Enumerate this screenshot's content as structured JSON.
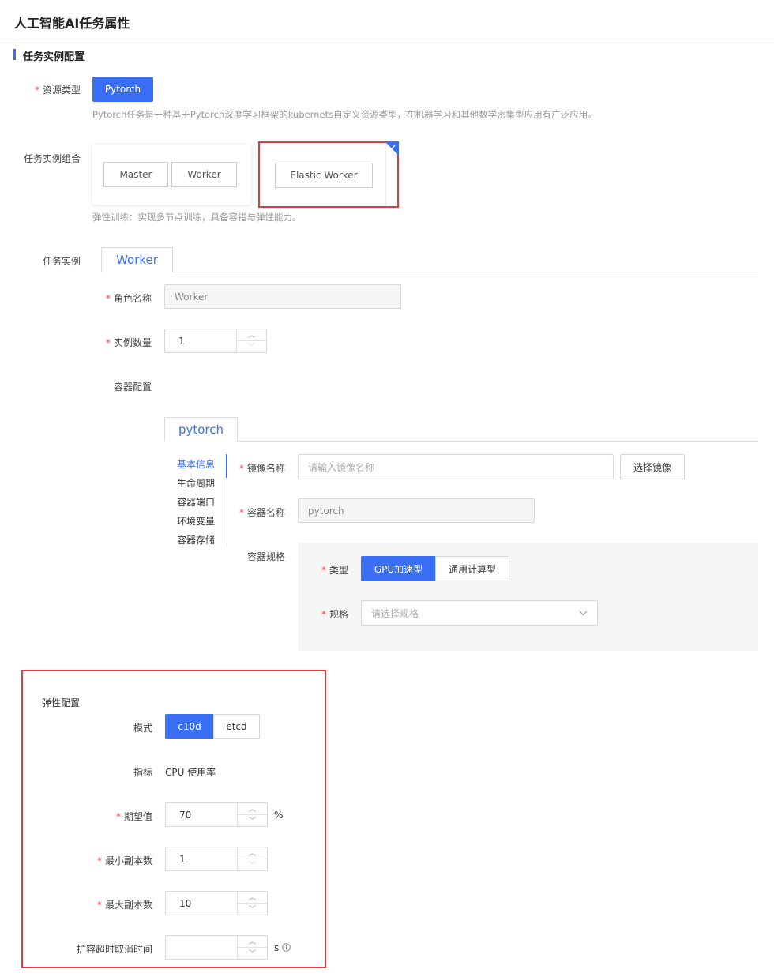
{
  "page_title": "人工智能AI任务属性",
  "section_title": "任务实例配置",
  "resource_type": {
    "label": "资源类型",
    "button": "Pytorch",
    "hint": "Pytorch任务是一种基于Pytorch深度学习框架的kubernets自定义资源类型，在机器学习和其他数学密集型应用有广泛应用。"
  },
  "instance_combo": {
    "label": "任务实例组合",
    "options": [
      {
        "buttons": [
          "Master",
          "Worker"
        ],
        "selected": false
      },
      {
        "buttons": [
          "Elastic Worker"
        ],
        "selected": true
      }
    ],
    "hint": "弹性训练：实现多节点训练，具备容错与弹性能力。"
  },
  "task_instance": {
    "label": "任务实例",
    "tab": "Worker",
    "role_name_label": "角色名称",
    "role_name_value": "Worker",
    "instance_count_label": "实例数量",
    "instance_count_value": "1",
    "container_config_label": "容器配置"
  },
  "container": {
    "tab": "pytorch",
    "menu": [
      "基本信息",
      "生命周期",
      "容器端口",
      "环境变量",
      "容器存储"
    ],
    "active_menu": "基本信息",
    "image_name_label": "镜像名称",
    "image_name_placeholder": "请输入镜像名称",
    "select_image_button": "选择镜像",
    "container_name_label": "容器名称",
    "container_name_value": "pytorch",
    "spec_label": "容器规格",
    "type_label": "类型",
    "type_options": [
      "GPU加速型",
      "通用计算型"
    ],
    "type_selected": "GPU加速型",
    "size_label": "规格",
    "size_placeholder": "请选择规格"
  },
  "elastic": {
    "title": "弹性配置",
    "mode_label": "模式",
    "mode_options": [
      "c10d",
      "etcd"
    ],
    "mode_selected": "c10d",
    "metric_label": "指标",
    "metric_value": "CPU 使用率",
    "expected_label": "期望值",
    "expected_value": "70",
    "expected_unit": "%",
    "min_replicas_label": "最小副本数",
    "min_replicas_value": "1",
    "max_replicas_label": "最大副本数",
    "max_replicas_value": "10",
    "timeout_label": "扩容超时取消时间",
    "timeout_value": "",
    "timeout_unit": "s"
  },
  "colors": {
    "accent": "#3a6ef5",
    "required": "#f0443c",
    "highlight_border": "#e4393c"
  }
}
